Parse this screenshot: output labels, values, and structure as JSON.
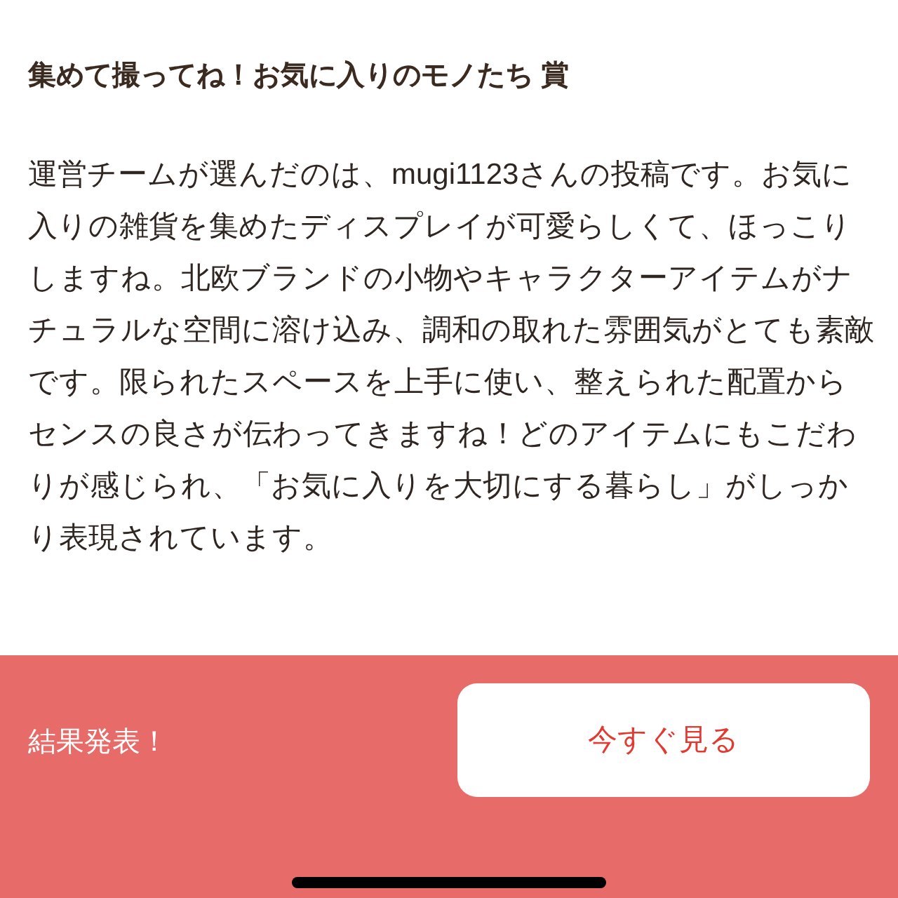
{
  "award": {
    "title": "集めて撮ってね！お気に入りのモノたち 賞",
    "body": "運営チームが選んだのは、mugi1123さんの投稿です。お気に入りの雑貨を集めたディスプレイが可愛らしくて、ほっこりしますね。北欧ブランドの小物やキャラクターアイテムがナチュラルな空間に溶け込み、調和の取れた雰囲気がとても素敵です。限られたスペースを上手に使い、整えられた配置からセンスの良さが伝わってきますね！どのアイテムにもこだわりが感じられ、「お気に入りを大切にする暮らし」がしっかり表現されています。"
  },
  "bottom_bar": {
    "label": "結果発表！",
    "button": "今すぐ見る"
  }
}
